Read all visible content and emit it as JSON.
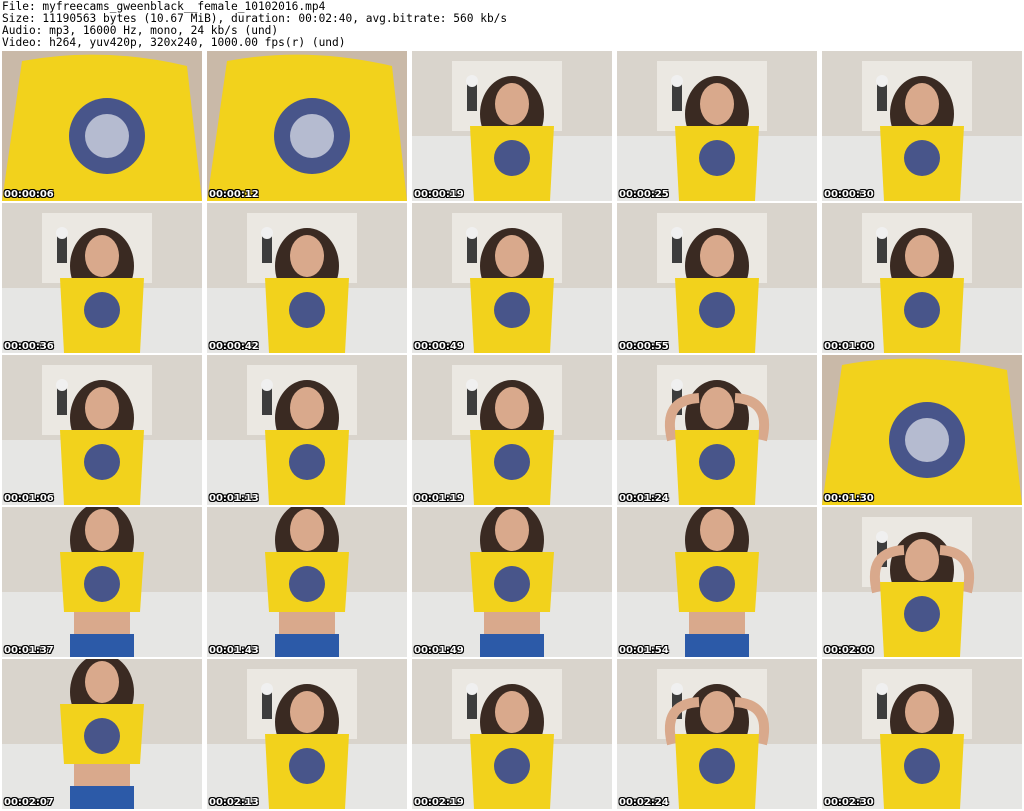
{
  "header": {
    "file_line": "File: myfreecams_gweenblack__female_10102016.mp4",
    "size_line": "Size: 11190563 bytes (10.67 MiB), duration: 00:02:40, avg.bitrate: 560 kb/s",
    "audio_line": "Audio: mp3, 16000 Hz, mono, 24 kb/s (und)",
    "video_line": "Video: h264, yuv420p, 320x240, 1000.00 fps(r) (und)"
  },
  "colors": {
    "wall": "#d9d4cc",
    "sofa": "#e6e6e4",
    "shirt": "#f2d21c",
    "print": "#2a3f9e",
    "hair": "#3a2a22",
    "skin": "#d9a98c",
    "jeans": "#2c5aa8"
  },
  "thumbnails": [
    {
      "time": "00:00:06",
      "scene": "closeup"
    },
    {
      "time": "00:00:12",
      "scene": "closeup"
    },
    {
      "time": "00:00:19",
      "scene": "seated"
    },
    {
      "time": "00:00:25",
      "scene": "seated"
    },
    {
      "time": "00:00:30",
      "scene": "seated"
    },
    {
      "time": "00:00:36",
      "scene": "seated"
    },
    {
      "time": "00:00:42",
      "scene": "seated"
    },
    {
      "time": "00:00:49",
      "scene": "seated"
    },
    {
      "time": "00:00:55",
      "scene": "seated"
    },
    {
      "time": "00:01:00",
      "scene": "seated"
    },
    {
      "time": "00:01:06",
      "scene": "seated"
    },
    {
      "time": "00:01:13",
      "scene": "seated"
    },
    {
      "time": "00:01:19",
      "scene": "seated"
    },
    {
      "time": "00:01:24",
      "scene": "arms-up"
    },
    {
      "time": "00:01:30",
      "scene": "closeup"
    },
    {
      "time": "00:01:37",
      "scene": "standing"
    },
    {
      "time": "00:01:43",
      "scene": "standing"
    },
    {
      "time": "00:01:49",
      "scene": "standing"
    },
    {
      "time": "00:01:54",
      "scene": "standing"
    },
    {
      "time": "00:02:00",
      "scene": "arms-up"
    },
    {
      "time": "00:02:07",
      "scene": "standing"
    },
    {
      "time": "00:02:13",
      "scene": "seated"
    },
    {
      "time": "00:02:19",
      "scene": "seated"
    },
    {
      "time": "00:02:24",
      "scene": "arms-up"
    },
    {
      "time": "00:02:30",
      "scene": "seated"
    }
  ]
}
